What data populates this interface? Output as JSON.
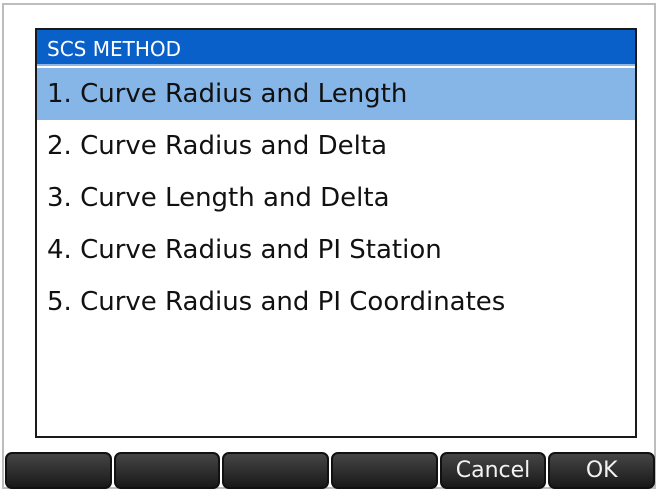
{
  "dialog": {
    "title": "SCS METHOD",
    "items": [
      {
        "label": "1. Curve Radius and Length",
        "selected": true
      },
      {
        "label": "2. Curve Radius and Delta",
        "selected": false
      },
      {
        "label": "3. Curve Length and Delta",
        "selected": false
      },
      {
        "label": "4. Curve Radius and PI Station",
        "selected": false
      },
      {
        "label": "5. Curve Radius and PI Coordinates",
        "selected": false
      }
    ]
  },
  "softkeys": {
    "key1": "",
    "key2": "",
    "key3": "",
    "key4": "",
    "cancel": "Cancel",
    "ok": "OK"
  },
  "colors": {
    "title_bar": "#0a60c9",
    "selection": "#86b6e8",
    "softkey": "#2a2a2a"
  }
}
